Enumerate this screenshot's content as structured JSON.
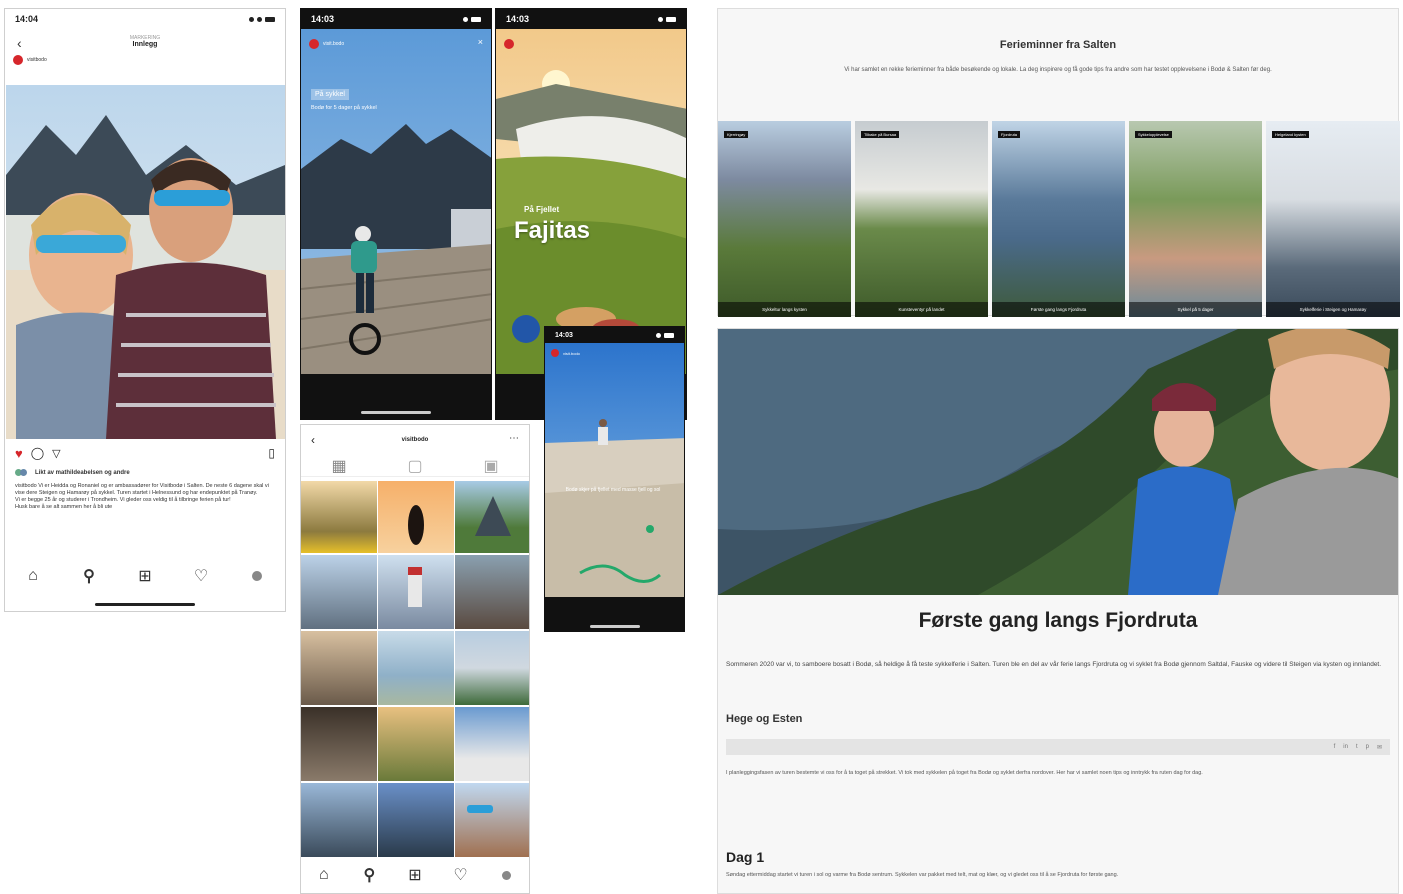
{
  "post": {
    "time": "14:04",
    "header_small": "MARKERING",
    "header_title": "Innlegg",
    "account": "visitbodo",
    "action_label": "Liker",
    "likes_text": "Likt av mathildeabelsen og andre",
    "caption_1": "visitbodo Vi er Heidda og Ronaniel og er ambassadører for Visitbodø i Salten. De neste 6 dagene skal vi vise dere Steigen og Hamarøy på sykkel. Turen startet i Helnessund og har endepunktet på Tranøy.",
    "caption_2": "Vi er begge 25 år og studerer i Trondheim. Vi gleder oss veldig til å tilbringe ferien på tur!",
    "caption_3": "Husk bare å se alt sammen her å bli ute"
  },
  "story1": {
    "time": "14:03",
    "account": "visit.bodo",
    "headline": "På sykkel",
    "subline": "Bodø for 5 dager på sykkel"
  },
  "story2": {
    "time": "14:03",
    "kicker": "På Fjellet",
    "headline": "Fajitas"
  },
  "story3": {
    "time": "14:03",
    "account": "visit.bodo",
    "text": "Bodø skjer på fjellet med masse fjell og sol"
  },
  "profile": {
    "title": "visitbodo"
  },
  "web_top": {
    "title": "Ferieminner fra Salten",
    "intro": "Vi har samlet en rekke ferieminner fra både besøkende og lokale. La deg inspirere og få gode tips fra andre som har testet opplevelsene i Bodø & Salten før deg.",
    "cards": [
      {
        "tag": "Kjerringøy",
        "caption": "Sykkeltur langs kysten"
      },
      {
        "tag": "Tilbake på Bursaa",
        "caption": "Kunsteventyr på landet"
      },
      {
        "tag": "Fjordruta",
        "caption": "Første gang langs Fjordruta"
      },
      {
        "tag": "Sykkelopplevelse",
        "caption": "Sykkel på 5 dager"
      },
      {
        "tag": "Helgeland kysten",
        "caption": "Sykkelferie i Steigen og Hamarøy"
      }
    ]
  },
  "article": {
    "title": "Første gang langs Fjordruta",
    "lead": "Sommeren 2020 var vi, to samboere bosatt i Bodø, så heldige å få teste sykkelferie i Salten. Turen ble en del av vår ferie langs Fjordruta og vi syklet fra Bodø gjennom Saltdal, Fauske og videre til Steigen via kysten og innlandet.",
    "byline": "Hege og Esten",
    "body": "I planleggingsfasen av turen bestemte vi oss for å ta toget på strekket. Vi tok med sykkelen på toget fra Bodø og syklet derfra nordover. Her har vi samlet noen tips og inntrykk fra ruten dag for dag.",
    "day_heading": "Dag 1",
    "day_text": "Søndag ettermiddag startet vi turen i sol og varme fra Bodø sentrum. Sykkelen var pakket med telt, mat og klær, og vi gledet oss til å se Fjordruta for første gang."
  },
  "colors": {
    "accent_red": "#d6262b"
  }
}
